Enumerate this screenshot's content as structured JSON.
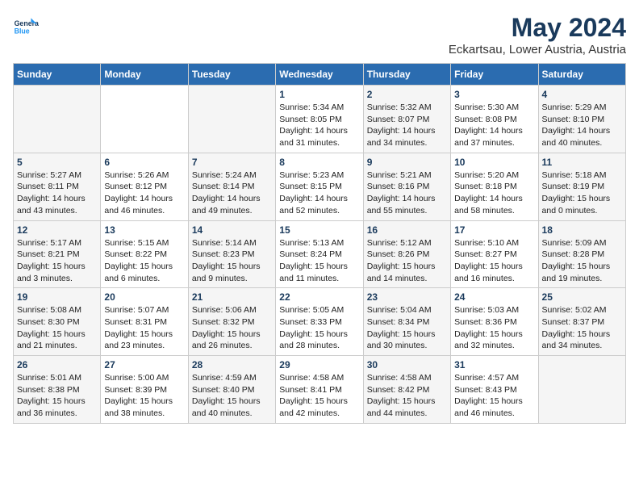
{
  "header": {
    "logo_line1": "General",
    "logo_line2": "Blue",
    "title": "May 2024",
    "subtitle": "Eckartsau, Lower Austria, Austria"
  },
  "columns": [
    "Sunday",
    "Monday",
    "Tuesday",
    "Wednesday",
    "Thursday",
    "Friday",
    "Saturday"
  ],
  "weeks": [
    [
      {
        "day": "",
        "info": ""
      },
      {
        "day": "",
        "info": ""
      },
      {
        "day": "",
        "info": ""
      },
      {
        "day": "1",
        "info": "Sunrise: 5:34 AM\nSunset: 8:05 PM\nDaylight: 14 hours and 31 minutes."
      },
      {
        "day": "2",
        "info": "Sunrise: 5:32 AM\nSunset: 8:07 PM\nDaylight: 14 hours and 34 minutes."
      },
      {
        "day": "3",
        "info": "Sunrise: 5:30 AM\nSunset: 8:08 PM\nDaylight: 14 hours and 37 minutes."
      },
      {
        "day": "4",
        "info": "Sunrise: 5:29 AM\nSunset: 8:10 PM\nDaylight: 14 hours and 40 minutes."
      }
    ],
    [
      {
        "day": "5",
        "info": "Sunrise: 5:27 AM\nSunset: 8:11 PM\nDaylight: 14 hours and 43 minutes."
      },
      {
        "day": "6",
        "info": "Sunrise: 5:26 AM\nSunset: 8:12 PM\nDaylight: 14 hours and 46 minutes."
      },
      {
        "day": "7",
        "info": "Sunrise: 5:24 AM\nSunset: 8:14 PM\nDaylight: 14 hours and 49 minutes."
      },
      {
        "day": "8",
        "info": "Sunrise: 5:23 AM\nSunset: 8:15 PM\nDaylight: 14 hours and 52 minutes."
      },
      {
        "day": "9",
        "info": "Sunrise: 5:21 AM\nSunset: 8:16 PM\nDaylight: 14 hours and 55 minutes."
      },
      {
        "day": "10",
        "info": "Sunrise: 5:20 AM\nSunset: 8:18 PM\nDaylight: 14 hours and 58 minutes."
      },
      {
        "day": "11",
        "info": "Sunrise: 5:18 AM\nSunset: 8:19 PM\nDaylight: 15 hours and 0 minutes."
      }
    ],
    [
      {
        "day": "12",
        "info": "Sunrise: 5:17 AM\nSunset: 8:21 PM\nDaylight: 15 hours and 3 minutes."
      },
      {
        "day": "13",
        "info": "Sunrise: 5:15 AM\nSunset: 8:22 PM\nDaylight: 15 hours and 6 minutes."
      },
      {
        "day": "14",
        "info": "Sunrise: 5:14 AM\nSunset: 8:23 PM\nDaylight: 15 hours and 9 minutes."
      },
      {
        "day": "15",
        "info": "Sunrise: 5:13 AM\nSunset: 8:24 PM\nDaylight: 15 hours and 11 minutes."
      },
      {
        "day": "16",
        "info": "Sunrise: 5:12 AM\nSunset: 8:26 PM\nDaylight: 15 hours and 14 minutes."
      },
      {
        "day": "17",
        "info": "Sunrise: 5:10 AM\nSunset: 8:27 PM\nDaylight: 15 hours and 16 minutes."
      },
      {
        "day": "18",
        "info": "Sunrise: 5:09 AM\nSunset: 8:28 PM\nDaylight: 15 hours and 19 minutes."
      }
    ],
    [
      {
        "day": "19",
        "info": "Sunrise: 5:08 AM\nSunset: 8:30 PM\nDaylight: 15 hours and 21 minutes."
      },
      {
        "day": "20",
        "info": "Sunrise: 5:07 AM\nSunset: 8:31 PM\nDaylight: 15 hours and 23 minutes."
      },
      {
        "day": "21",
        "info": "Sunrise: 5:06 AM\nSunset: 8:32 PM\nDaylight: 15 hours and 26 minutes."
      },
      {
        "day": "22",
        "info": "Sunrise: 5:05 AM\nSunset: 8:33 PM\nDaylight: 15 hours and 28 minutes."
      },
      {
        "day": "23",
        "info": "Sunrise: 5:04 AM\nSunset: 8:34 PM\nDaylight: 15 hours and 30 minutes."
      },
      {
        "day": "24",
        "info": "Sunrise: 5:03 AM\nSunset: 8:36 PM\nDaylight: 15 hours and 32 minutes."
      },
      {
        "day": "25",
        "info": "Sunrise: 5:02 AM\nSunset: 8:37 PM\nDaylight: 15 hours and 34 minutes."
      }
    ],
    [
      {
        "day": "26",
        "info": "Sunrise: 5:01 AM\nSunset: 8:38 PM\nDaylight: 15 hours and 36 minutes."
      },
      {
        "day": "27",
        "info": "Sunrise: 5:00 AM\nSunset: 8:39 PM\nDaylight: 15 hours and 38 minutes."
      },
      {
        "day": "28",
        "info": "Sunrise: 4:59 AM\nSunset: 8:40 PM\nDaylight: 15 hours and 40 minutes."
      },
      {
        "day": "29",
        "info": "Sunrise: 4:58 AM\nSunset: 8:41 PM\nDaylight: 15 hours and 42 minutes."
      },
      {
        "day": "30",
        "info": "Sunrise: 4:58 AM\nSunset: 8:42 PM\nDaylight: 15 hours and 44 minutes."
      },
      {
        "day": "31",
        "info": "Sunrise: 4:57 AM\nSunset: 8:43 PM\nDaylight: 15 hours and 46 minutes."
      },
      {
        "day": "",
        "info": ""
      }
    ]
  ]
}
